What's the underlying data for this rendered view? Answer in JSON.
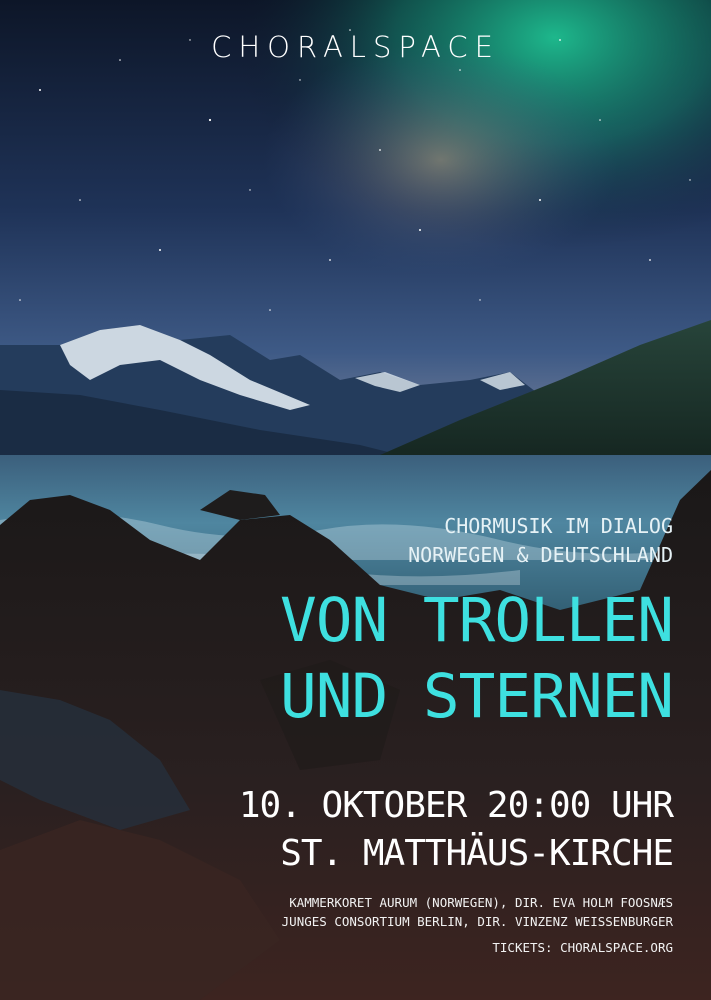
{
  "brand": {
    "logo": "CHORALSPACE"
  },
  "event": {
    "subtitle": [
      "CHORMUSIK IM DIALOG",
      "NORWEGEN & DEUTSCHLAND"
    ],
    "title": [
      "VON TROLLEN",
      "UND STERNEN"
    ],
    "datetime": "10. OKTOBER 20:00 UHR",
    "venue": "ST. MATTHÄUS-KIRCHE",
    "performers": [
      "KAMMERKORET AURUM (NORWEGEN), DIR. EVA HOLM FOOSNÆS",
      "JUNGES CONSORTIUM BERLIN, DIR. VINZENZ WEISSENBURGER"
    ],
    "tickets": "TICKETS: CHORALSPACE.ORG"
  },
  "colors": {
    "accent": "#3ee0e0",
    "sky_top": "#0f1a2e",
    "aurora": "#1fb98f",
    "water": "#4a7e9a"
  }
}
